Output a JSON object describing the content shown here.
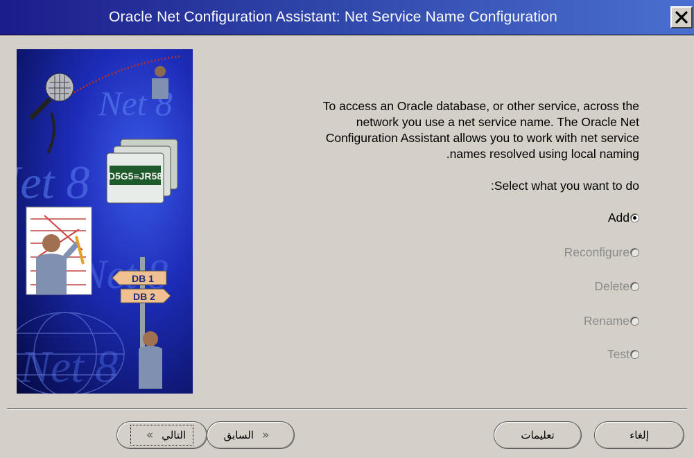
{
  "window": {
    "title": "Oracle Net Configuration Assistant: Net Service Name Configuration",
    "close_icon": "close-icon"
  },
  "content": {
    "description_lines": [
      "To access an Oracle database, or other service, across the",
      "network you use a net service name. The Oracle Net",
      "Configuration Assistant allows you to work with net service",
      ".names resolved using local naming"
    ],
    "prompt": ":Select what you want to do",
    "options": [
      {
        "label": "Add",
        "selected": true,
        "enabled": true
      },
      {
        "label": "Reconfigure",
        "selected": false,
        "enabled": false
      },
      {
        "label": "Delete",
        "selected": false,
        "enabled": false
      },
      {
        "label": "Rename",
        "selected": false,
        "enabled": false
      },
      {
        "label": "Test",
        "selected": false,
        "enabled": false
      }
    ]
  },
  "artwork": {
    "folder_label": "D5G5≡JR58",
    "signs": [
      "DB 1",
      "DB 2"
    ],
    "watermark": "Net 8"
  },
  "buttons": {
    "next": "التالي",
    "back": "السابق",
    "help": "تعليمات",
    "cancel": "إلغاء"
  }
}
